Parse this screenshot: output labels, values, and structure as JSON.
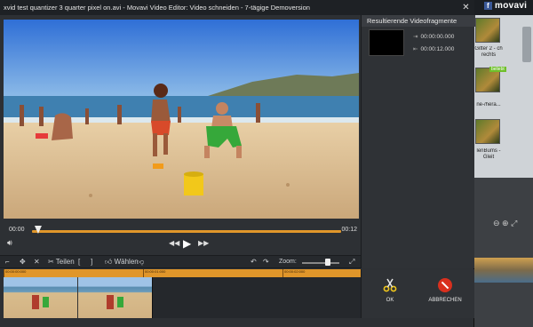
{
  "window": {
    "title": "xvid test quantizer 3 quarter pixel on.avi - Movavi Video Editor: Video schneiden - 7-tägige Demoversion",
    "close_symbol": "✕"
  },
  "background_app": {
    "logo_text": "movavi",
    "thumb_captions": [
      "Gitter 2 - ch rechts",
      "ne-/hera...",
      "lenBums - Gleit"
    ],
    "badge": "beliebt"
  },
  "player": {
    "time_start": "00:00",
    "time_end": "00:12",
    "progress_fraction": 0.02
  },
  "toolbar": {
    "split_label": "Teilen",
    "select_label": "Wählen",
    "zoom_label": "Zoom:",
    "zoom_fraction": 0.7
  },
  "ruler": {
    "labels": [
      "00:00:00:000",
      "00:00:01:000",
      "00:00:02:000",
      "00:00:03:000"
    ]
  },
  "result_panel": {
    "header": "Resultierende Videofragmente",
    "start_time": "00:00:00.000",
    "end_time": "00:00:12.000"
  },
  "actions": {
    "ok_label": "OK",
    "cancel_label": "ABBRECHEN"
  },
  "colors": {
    "accent": "#e0962a",
    "cancel_red": "#d9301e",
    "dialog_bg": "#2d3034"
  },
  "icons": [
    "close-icon",
    "volume-icon",
    "prev-frame-icon",
    "play-icon",
    "next-frame-icon",
    "scissors-icon",
    "stop-icon"
  ]
}
